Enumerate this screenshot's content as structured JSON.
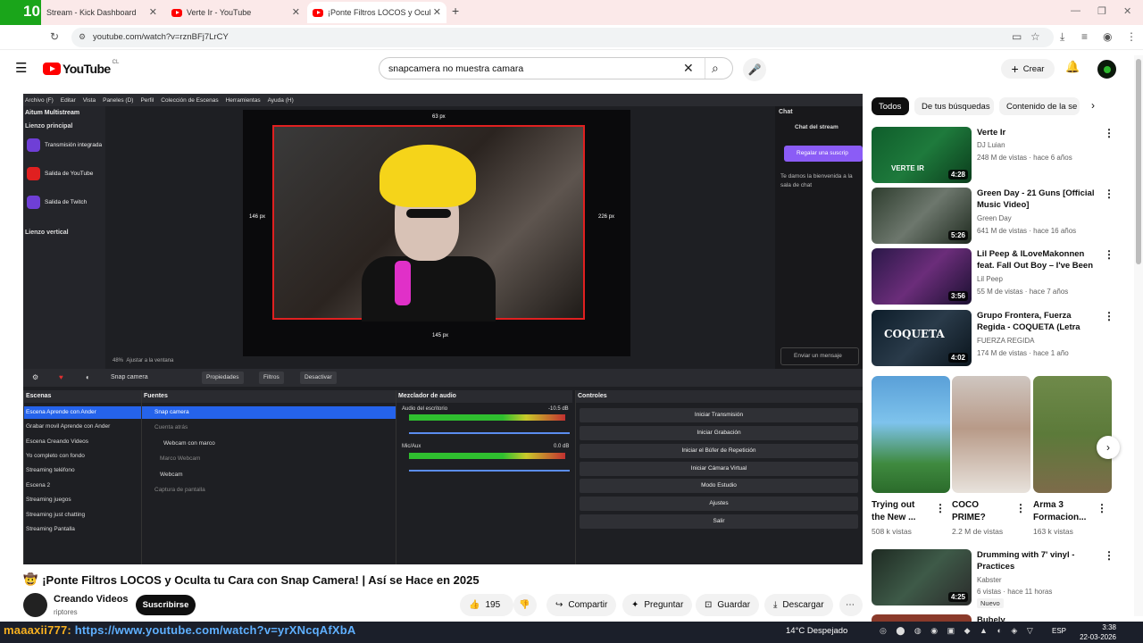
{
  "browser": {
    "overlay_count_top": "10",
    "overlay_count_second": "1",
    "tabs": [
      {
        "label": "Stream - Kick Dashboard"
      },
      {
        "label": "Verte Ir - YouTube"
      },
      {
        "label": "¡Ponte Filtros LOCOS y Ocul"
      }
    ],
    "new_tab": "+",
    "address": "youtube.com/watch?v=rznBFj7LrCY"
  },
  "yt": {
    "logo_text": "YouTube",
    "country": "CL",
    "search_value": "snapcamera no muestra camara",
    "create_label": "Crear"
  },
  "obs": {
    "menu": [
      "Archivo (F)",
      "Editar",
      "Vista",
      "Paneles (D)",
      "Perfil",
      "Colección de Escenas",
      "Herramientas",
      "Ayuda (H)"
    ],
    "multistream_title": "Aitum Multistream",
    "canvas_main": "Lienzo principal",
    "canvas_items": [
      "Transmisión integrada",
      "Salida de YouTube",
      "Salida de Twitch"
    ],
    "canvas_vertical": "Lienzo vertical",
    "px_labels": {
      "top": "63 px",
      "left": "146 px",
      "right": "226 px",
      "bottom": "145 px"
    },
    "chat_title": "Chat",
    "chat_stream": "Chat del stream",
    "gift_btn": "Regalar una suscrip",
    "welcome": "Te damos la bienvenida a la sala de chat",
    "send_msg": "Enviar un mensaje",
    "source_name": "Snap camera",
    "zoom": "48%",
    "fit_window": "Ajustar a la ventana",
    "prop_btn": "Propiedades",
    "filter_btn": "Filtros",
    "deact_btn": "Desactivar",
    "scenes_title": "Escenas",
    "scenes": [
      "Escena Aprende con Ander",
      "Grabar movil Aprende con Ander",
      "Escena Creando Videos",
      "Yo completo con fondo",
      "Streaming teléfono",
      "Escena 2",
      "Streaming juegos",
      "Streaming just chatting",
      "Streaming Pantalla"
    ],
    "sources_title": "Fuentes",
    "sources": [
      "Snap camera",
      "Cuenta atrás",
      "Webcam con marco",
      "Marco Webcam",
      "Webcam",
      "Captura de pantalla"
    ],
    "mixer_title": "Mezclador de audio",
    "mixer_desktop": "Audio del escritorio",
    "mixer_desktop_db": "-10.5 dB",
    "mixer_mic": "Mic/Aux",
    "mixer_mic_db": "0.0 dB",
    "controls_title": "Controles",
    "controls": [
      "Iniciar Transmisión",
      "Iniciar Grabación",
      "Iniciar el Búfer de Repetición",
      "Iniciar Cámara Virtual",
      "Modo Estudio",
      "Ajustes",
      "Salir"
    ]
  },
  "video": {
    "title_emoji": "🤠",
    "title": "¡Ponte Filtros LOCOS y Oculta tu Cara con Snap Camera! | Así se Hace en 2025",
    "channel": "Creando Videos",
    "subs_partial": "riptores",
    "subscribe": "Suscribirse",
    "likes": "195",
    "share": "Compartir",
    "ask": "Preguntar",
    "save": "Guardar",
    "download": "Descargar"
  },
  "chips": [
    "Todos",
    "De tus búsquedas",
    "Contenido de la se"
  ],
  "recs": [
    {
      "title": "Verte Ir",
      "channel": "DJ Luian",
      "meta": "248 M de vistas · hace 6 años",
      "duration": "4:28",
      "thumb_caption": "VERTE IR"
    },
    {
      "title": "Green Day - 21 Guns [Official Music Video]",
      "channel": "Green Day",
      "meta": "641 M de vistas · hace 16 años",
      "duration": "5:26"
    },
    {
      "title": "Lil Peep & ILoveMakonnen feat. Fall Out Boy – I've Been Waiting",
      "channel": "Lil Peep",
      "meta": "55 M de vistas · hace 7 años",
      "duration": "3:56"
    },
    {
      "title": "Grupo Frontera, Fuerza Regida - COQUETA (Letra Oficial)",
      "channel": "FUERZA REGIDA",
      "meta": "174 M de vistas · hace 1 año",
      "duration": "4:02",
      "thumb_caption": "COQUETA"
    }
  ],
  "shorts": [
    {
      "title": "Trying out the New ...",
      "views": "508 k vistas"
    },
    {
      "title": "COCO PRIME?",
      "views": "2.2 M de vistas"
    },
    {
      "title": "Arma 3 Formacion...",
      "views": "163 k vistas"
    }
  ],
  "rec5": {
    "title": "Drumming with 7' vinyl - Practices",
    "channel": "Kabster",
    "meta": "6 vistas · hace 11 horas",
    "badge": "Nuevo",
    "duration": "4:25"
  },
  "rec6_partial": "Bubely",
  "taskbar": {
    "overlay_user": "maaaxii777",
    "overlay_url": "https://www.youtube.com/watch?v=yrXNcqAfXbA",
    "weather": "14°C  Despejado",
    "lang": "ESP",
    "time": "3:38",
    "date": "22-03-2026"
  },
  "colors": {
    "yt_red": "#ff0000",
    "obs_selected": "#2563eb",
    "twitch_purple": "#6f3fd6",
    "kick_green": "#1aa51a"
  }
}
